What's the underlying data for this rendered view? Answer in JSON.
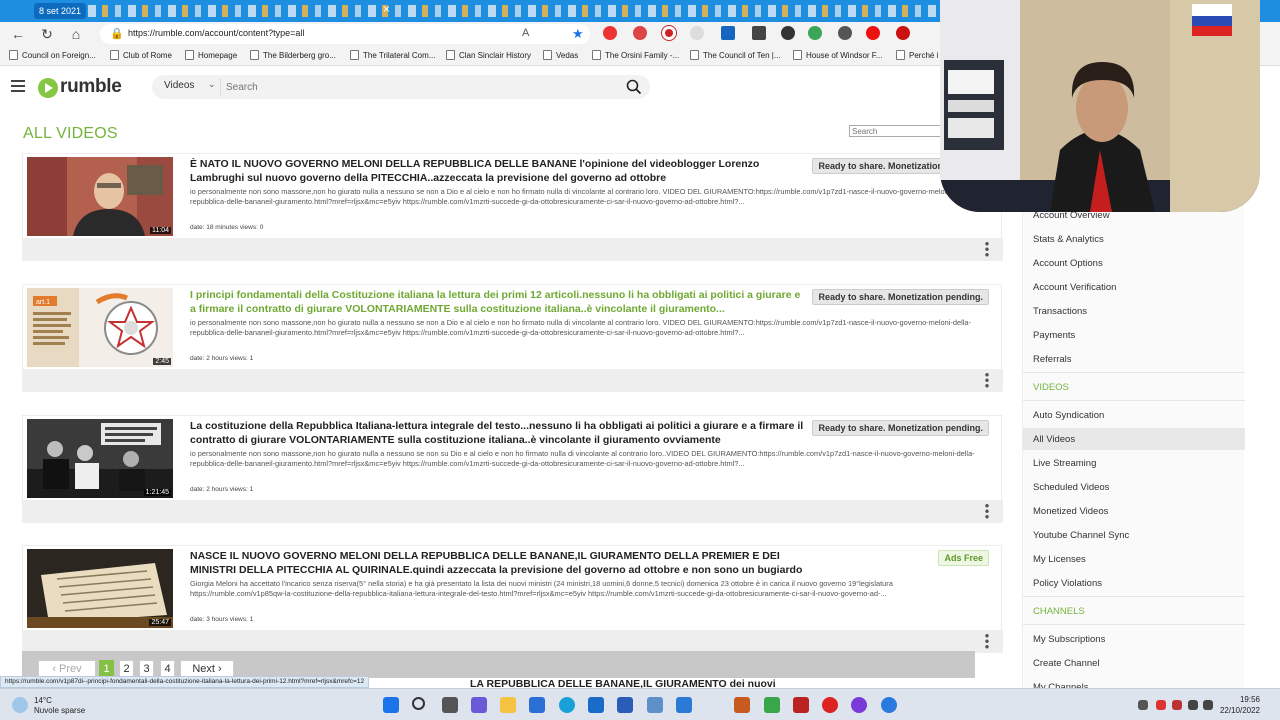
{
  "browser": {
    "tab_date": "8 set 2021",
    "url": "https://rumble.com/account/content?type=all",
    "bookmarks": [
      "Council on Foreign...",
      "Club of Rome",
      "Homepage",
      "The Bilderberg gro...",
      "The Trilateral Com...",
      "Clan Sinclair History",
      "Vedas",
      "The Orsini Family -...",
      "The Council of Ten |...",
      "House of Windsor F...",
      "Perché i"
    ],
    "status_url": "https://rumble.com/v1p87di--principi-fondamentali-della-costituzione-italiana-la-lettura-dei-primi-12.html?mref=rljsx&mrefc=12"
  },
  "header": {
    "logo_text": "rumble",
    "search_category": "Videos",
    "search_placeholder": "Search"
  },
  "main": {
    "title": "ALL VIDEOS",
    "list_search_placeholder": "Search"
  },
  "videos": [
    {
      "title": "È NATO IL NUOVO GOVERNO MELONI DELLA REPUBBLICA DELLE BANANE l'opinione del videoblogger Lorenzo Lambrughi sul nuovo governo della PITECCHIA..azzeccata la previsione del governo ad ottobre",
      "description": "io personalmente non sono massone,non ho giurato nulla a nessuno se non a Dio e al cielo e non ho firmato nulla di vincolante al contrario loro. VIDEO DEL GIURAMENTO:https://rumble.com/v1p7zd1-nasce-il-nuovo-governo-meloni-della-repubblica-delle-bananeil-giuramento.html?mref=rljsx&mc=e5yiv https://rumble.com/v1mzrti-succede-gi-da-ottobresicuramente-ci-sar-il-nuovo-governo-ad-ottobre.html?...",
      "meta": "date: 18 minutes  views: 0",
      "duration": "11:04",
      "badge": "Ready to share. Monetization pending.",
      "title_color": "dark"
    },
    {
      "title": "I principi fondamentali della Costituzione italiana la lettura dei primi 12 articoli.nessuno li ha obbligati ai politici a giurare e a firmare il contratto di giurare VOLONTARIAMENTE sulla costituzione italiana..è vincolante il giuramento...",
      "description": "io personalmente non sono massone,non ho giurato nulla a nessuno se non a Dio e al cielo e non ho firmato nulla di vincolante al contrario loro. VIDEO DEL GIURAMENTO:https://rumble.com/v1p7zd1-nasce-il-nuovo-governo-meloni-della-repubblica-delle-bananeil-giuramento.html?mref=rljsx&mc=e5yiv https://rumble.com/v1mzrti-succede-gi-da-ottobresicuramente-ci-sar-il-nuovo-governo-ad-ottobre.html?...",
      "meta": "date: 2 hours  views: 1",
      "duration": "2:45",
      "badge": "Ready to share. Monetization pending.",
      "title_color": "green"
    },
    {
      "title": "La costituzione della Repubblica Italiana-lettura integrale del testo...nessuno li ha obbligati ai politici a giurare e a firmare il contratto di giurare VOLONTARIAMENTE sulla costituzione italiana..è vincolante il giuramento ovviamente",
      "description": "io personalmente non sono massone,non ho giurato nulla a nessuno se non su Dio e al cielo e non ho firmato nulla di vincolante al contrario loro..VIDEO DEL GIURAMENTO:https://rumble.com/v1p7zd1-nasce-il-nuovo-governo-meloni-della-repubblica-delle-bananeil-giuramento.html?mref=rljsx&mc=e5yiv https://rumble.com/v1mzrti-succede-gi-da-ottobresicuramente-ci-sar-il-nuovo-governo-ad-ottobre.html?...",
      "meta": "date: 2 hours  views: 1",
      "duration": "1:21:45",
      "badge": "Ready to share. Monetization pending.",
      "title_color": "dark"
    },
    {
      "title": "NASCE IL NUOVO GOVERNO MELONI DELLA REPUBBLICA DELLE BANANE,IL GIURAMENTO DELLA PREMIER E DEI MINISTRI DELLA PITECCHIA AL QUIRINALE.quindi azzeccata la previsione del governo ad ottobre e non sono un bugiardo",
      "description": "Giorgia Meloni ha accettato l'incarico senza riserva(5° nella storia) e ha già presentato la lista dei nuovi ministri (24 ministri,18 uomini,6 donne,5 tecnici) domenica 23 ottobre è in carica il nuovo governo 19°legislatura https://rumble.com/v1p85qw-la-costituzione-della-repubblica-italiana-lettura-integrale-del-testo.html?mref=rljsx&mc=e5yiv https://rumble.com/v1mzrti-succede-gi-da-ottobresicuramente-ci-sar-il-nuovo-governo-ad-...",
      "meta": "date: 3 hours  views: 1",
      "duration": "25:47",
      "badge": "Ads Free",
      "title_color": "dark"
    }
  ],
  "pagination": {
    "prev": "Prev",
    "pages": [
      "1",
      "2",
      "3",
      "4"
    ],
    "active": "1",
    "next": "Next"
  },
  "next_card_title": "LA REPUBBLICA DELLE BANANE,IL GIURAMENTO dei nuovi",
  "sidebar": {
    "account_items": [
      "Account Overview",
      "Stats & Analytics",
      "Account Options",
      "Account Verification",
      "Transactions",
      "Payments",
      "Referrals"
    ],
    "videos_heading": "VIDEOS",
    "video_items": [
      "Auto Syndication",
      "All Videos",
      "Live Streaming",
      "Scheduled Videos",
      "Monetized Videos",
      "Youtube Channel Sync",
      "My Licenses",
      "Policy Violations"
    ],
    "channels_heading": "CHANNELS",
    "channel_items": [
      "My Subscriptions",
      "Create Channel",
      "My Channels"
    ]
  },
  "taskbar": {
    "temperature": "14°C",
    "weather": "Nuvole sparse",
    "time": "19:56",
    "date": "22/10/2022"
  },
  "colors": {
    "brand_green": "#85c742",
    "heading_green": "#74b43d",
    "tabstrip_blue": "#1e8fe0"
  }
}
